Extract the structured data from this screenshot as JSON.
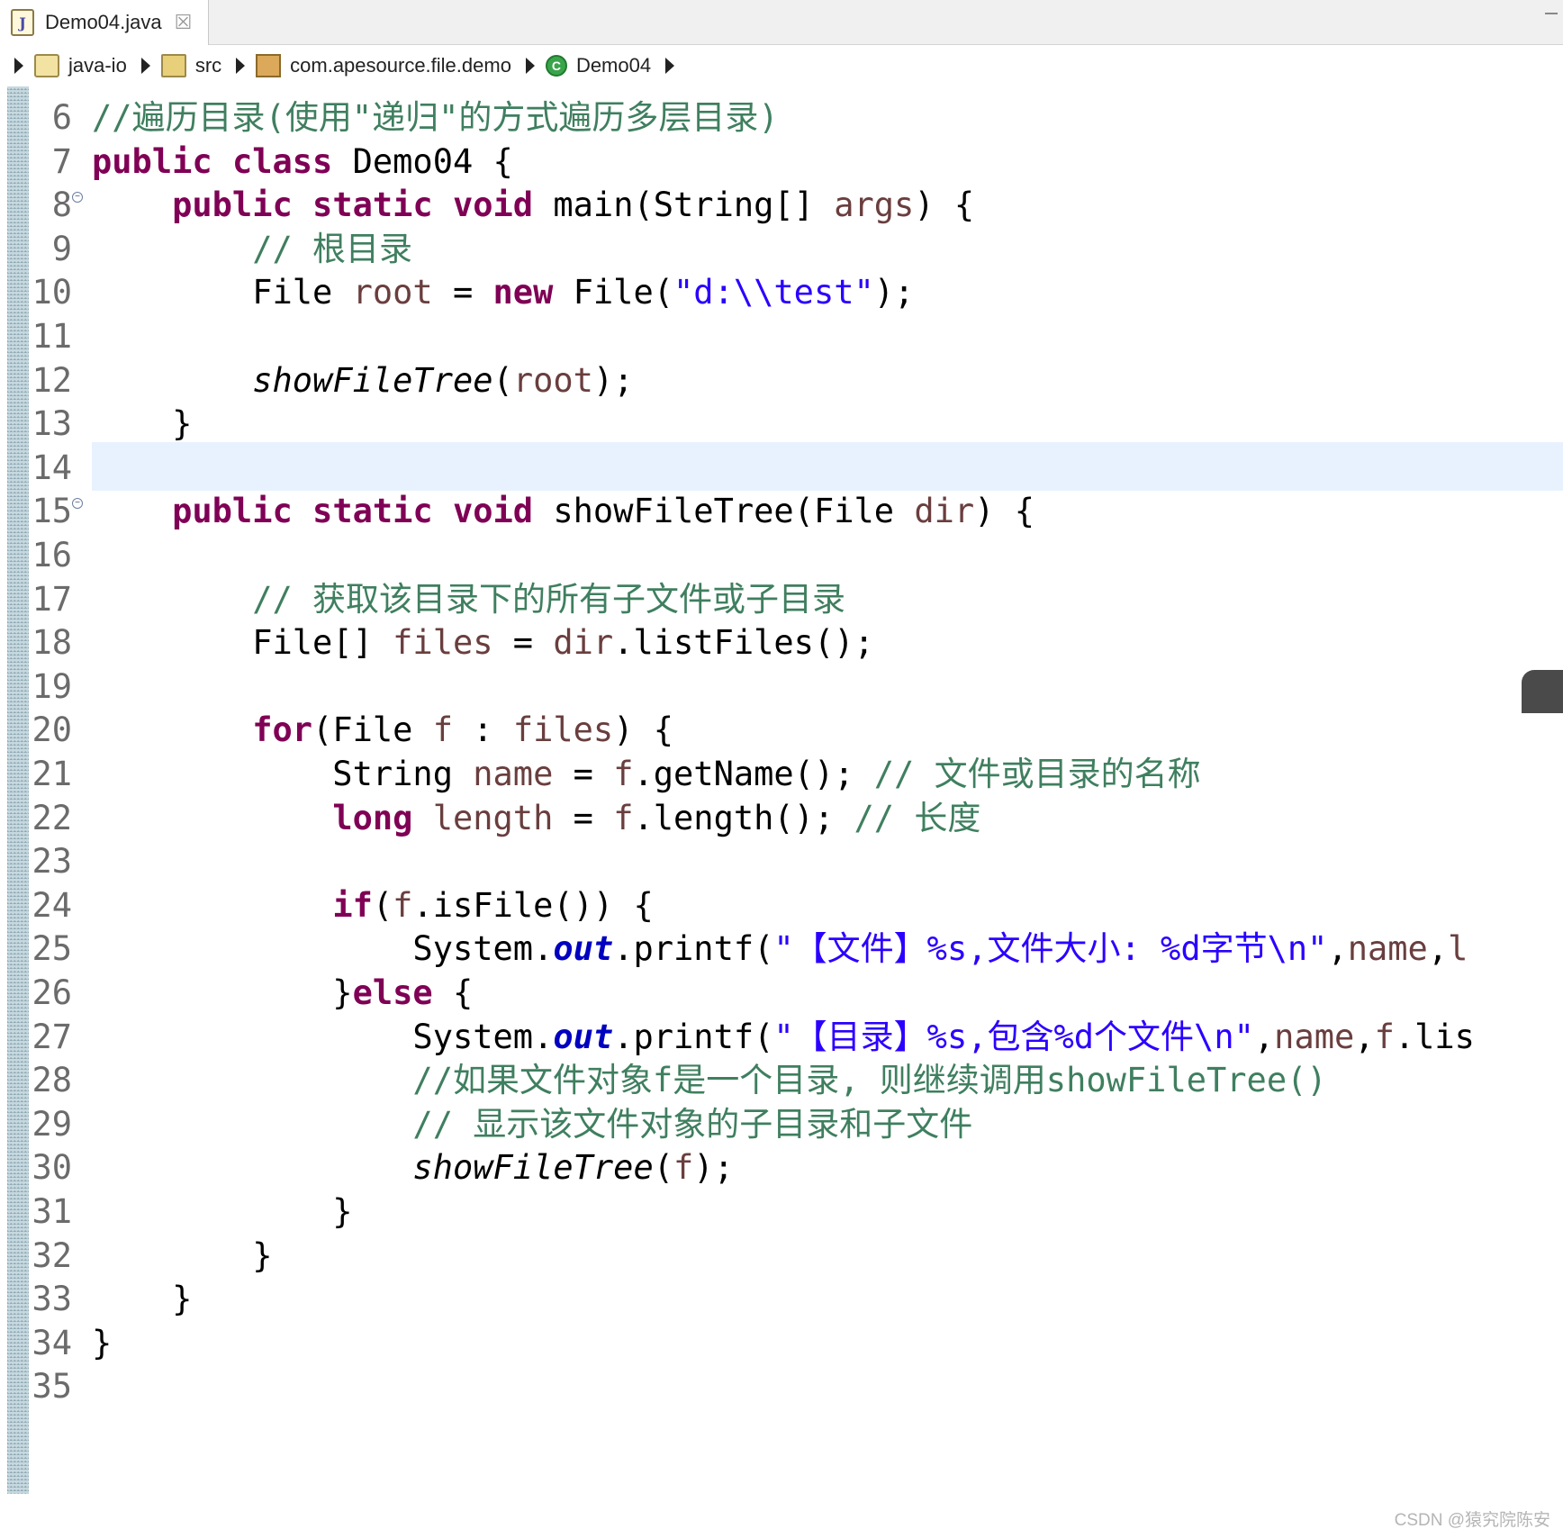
{
  "tab": {
    "title": "Demo04.java",
    "close_glyph": "☒"
  },
  "breadcrumb": [
    {
      "label": "java-io",
      "icon": "project-icon"
    },
    {
      "label": "src",
      "icon": "source-folder-icon"
    },
    {
      "label": "com.apesource.file.demo",
      "icon": "package-icon"
    },
    {
      "label": "Demo04",
      "icon": "class-icon"
    }
  ],
  "code_lines": [
    {
      "n": "6",
      "fold": false,
      "html": "<span class=\"cm\">//遍历目录(使用\"递归\"的方式遍历多层目录)</span>"
    },
    {
      "n": "7",
      "fold": false,
      "html": "<span class=\"kw\">public</span> <span class=\"kw\">class</span> Demo04 {"
    },
    {
      "n": "8",
      "fold": true,
      "html": "    <span class=\"kw\">public</span> <span class=\"kw\">static</span> <span class=\"kw\">void</span> main(String[] <span class=\"var\">args</span>) {"
    },
    {
      "n": "9",
      "fold": false,
      "html": "        <span class=\"cm\">// 根目录</span>"
    },
    {
      "n": "10",
      "fold": false,
      "html": "        File <span class=\"var\">root</span> = <span class=\"kw\">new</span> File(<span class=\"str\">\"d:\\\\test\"</span>);"
    },
    {
      "n": "11",
      "fold": false,
      "html": ""
    },
    {
      "n": "12",
      "fold": false,
      "html": "        <span class=\"it\">showFileTree</span>(<span class=\"var\">root</span>);"
    },
    {
      "n": "13",
      "fold": false,
      "html": "    }"
    },
    {
      "n": "14",
      "fold": false,
      "html": ""
    },
    {
      "n": "15",
      "fold": true,
      "html": "    <span class=\"kw\">public</span> <span class=\"kw\">static</span> <span class=\"kw\">void</span> showFileTree(File <span class=\"var\">dir</span>) {"
    },
    {
      "n": "16",
      "fold": false,
      "html": ""
    },
    {
      "n": "17",
      "fold": false,
      "html": "        <span class=\"cm\">// 获取该目录下的所有子文件或子目录</span>"
    },
    {
      "n": "18",
      "fold": false,
      "html": "        File[] <span class=\"var\">files</span> = <span class=\"var\">dir</span>.listFiles();"
    },
    {
      "n": "19",
      "fold": false,
      "html": ""
    },
    {
      "n": "20",
      "fold": false,
      "html": "        <span class=\"kw\">for</span>(File <span class=\"var\">f</span> : <span class=\"var\">files</span>) {"
    },
    {
      "n": "21",
      "fold": false,
      "html": "            String <span class=\"var\">name</span> = <span class=\"var\">f</span>.getName(); <span class=\"cm\">// 文件或目录的名称</span>"
    },
    {
      "n": "22",
      "fold": false,
      "html": "            <span class=\"kw\">long</span> <span class=\"var\">length</span> = <span class=\"var\">f</span>.length(); <span class=\"cm\">// 长度</span>"
    },
    {
      "n": "23",
      "fold": false,
      "html": ""
    },
    {
      "n": "24",
      "fold": false,
      "html": "            <span class=\"kw\">if</span>(<span class=\"var\">f</span>.isFile()) {"
    },
    {
      "n": "25",
      "fold": false,
      "html": "                System.<span class=\"fld\">out</span>.printf(<span class=\"str\">\"【文件】%s,文件大小: %d字节\\n\"</span>,<span class=\"var\">name</span>,<span class=\"var\">l</span>"
    },
    {
      "n": "26",
      "fold": false,
      "html": "            }<span class=\"kw\">else</span> {"
    },
    {
      "n": "27",
      "fold": false,
      "html": "                System.<span class=\"fld\">out</span>.printf(<span class=\"str\">\"【目录】%s,包含%d个文件\\n\"</span>,<span class=\"var\">name</span>,<span class=\"var\">f</span>.lis"
    },
    {
      "n": "28",
      "fold": false,
      "html": "                <span class=\"cm\">//如果文件对象f是一个目录, 则继续调用showFileTree()</span>"
    },
    {
      "n": "29",
      "fold": false,
      "html": "                <span class=\"cm\">// 显示该文件对象的子目录和子文件</span>"
    },
    {
      "n": "30",
      "fold": false,
      "html": "                <span class=\"it\">showFileTree</span>(<span class=\"var\">f</span>);"
    },
    {
      "n": "31",
      "fold": false,
      "html": "            }"
    },
    {
      "n": "32",
      "fold": false,
      "html": "        }"
    },
    {
      "n": "33",
      "fold": false,
      "html": "    }"
    },
    {
      "n": "34",
      "fold": false,
      "html": "}"
    },
    {
      "n": "35",
      "fold": false,
      "html": ""
    }
  ],
  "highlighted_line": "14",
  "watermark": "CSDN @猿究院陈安"
}
